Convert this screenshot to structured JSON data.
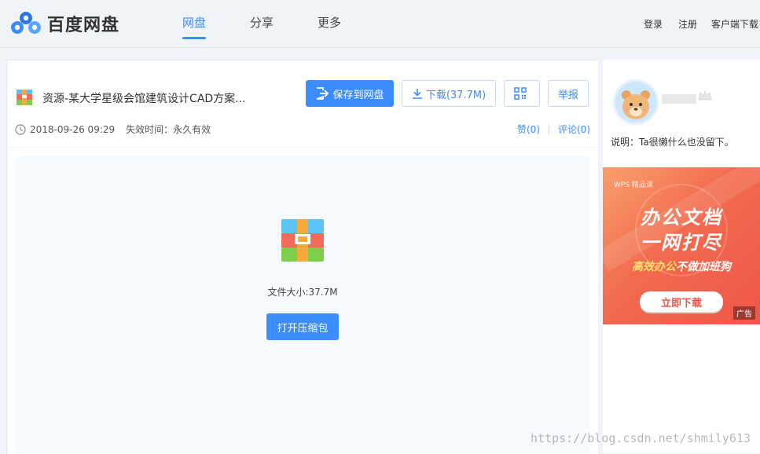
{
  "header": {
    "logo_text": "百度网盘",
    "nav": [
      {
        "label": "网盘",
        "active": true
      },
      {
        "label": "分享",
        "active": false
      },
      {
        "label": "更多",
        "active": false
      }
    ],
    "links": {
      "login": "登录",
      "register": "注册",
      "client_download": "客户端下载"
    }
  },
  "file": {
    "title": "资源-某大学星级会馆建筑设计CAD方案...",
    "date": "2018-09-26 09:29",
    "expiry": "失效时间：永久有效",
    "buttons": {
      "save": "保存到网盘",
      "download": "下载(37.7M)",
      "report": "举报"
    },
    "likes": "赞(0)",
    "comments": "评论(0)",
    "size_text": "文件大小:37.7M",
    "open_archive": "打开压缩包"
  },
  "sidebar": {
    "description": "说明：Ta很懒什么也没留下。"
  },
  "ad": {
    "brand": "WPS 精品课",
    "line1": "办公文档",
    "line2": "一网打尽",
    "sub_highlight": "高效办公",
    "sub_rest": "不做加班狗",
    "button": "立即下载",
    "tag": "广告"
  },
  "watermark": "https://blog.csdn.net/shmily613",
  "colors": {
    "accent": "#3b8cff",
    "ad_bg": "#f0564a"
  }
}
